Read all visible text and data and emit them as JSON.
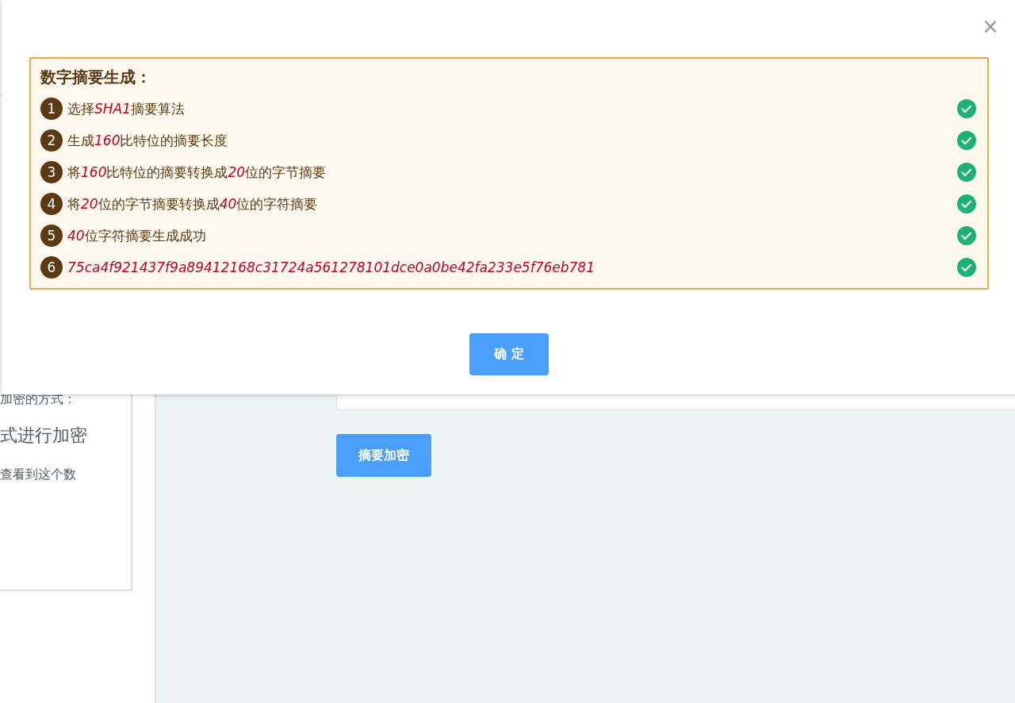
{
  "background": {
    "side_card": {
      "texts": [
        "加密的方式：",
        "式进行加密",
        "查看到这个数"
      ]
    },
    "main": {
      "button": "摘要加密"
    }
  },
  "dialog": {
    "close": "×",
    "panel": {
      "title": "数字摘要生成：",
      "steps": [
        {
          "number": "1",
          "parts": [
            {
              "text": "选择",
              "highlight": false
            },
            {
              "text": "SHA1",
              "highlight": true
            },
            {
              "text": "摘要算法",
              "highlight": false
            }
          ],
          "done": true
        },
        {
          "number": "2",
          "parts": [
            {
              "text": "生成",
              "highlight": false
            },
            {
              "text": "160",
              "highlight": true
            },
            {
              "text": "比特位的摘要长度",
              "highlight": false
            }
          ],
          "done": true
        },
        {
          "number": "3",
          "parts": [
            {
              "text": "将",
              "highlight": false
            },
            {
              "text": "160",
              "highlight": true
            },
            {
              "text": "比特位的摘要转换成",
              "highlight": false
            },
            {
              "text": "20",
              "highlight": true
            },
            {
              "text": "位的字节摘要",
              "highlight": false
            }
          ],
          "done": true
        },
        {
          "number": "4",
          "parts": [
            {
              "text": "将",
              "highlight": false
            },
            {
              "text": "20",
              "highlight": true
            },
            {
              "text": "位的字节摘要转换成",
              "highlight": false
            },
            {
              "text": "40",
              "highlight": true
            },
            {
              "text": "位的字符摘要",
              "highlight": false
            }
          ],
          "done": true
        },
        {
          "number": "5",
          "parts": [
            {
              "text": "40",
              "highlight": true
            },
            {
              "text": "位字符摘要生成成功",
              "highlight": false
            }
          ],
          "done": true
        },
        {
          "number": "6",
          "parts": [
            {
              "text": "75ca4f921437f9a89412168c31724a561278101dce0a0be42fa233e5f76eb781",
              "highlight": true
            }
          ],
          "done": true
        }
      ]
    },
    "confirm": "确 定"
  }
}
